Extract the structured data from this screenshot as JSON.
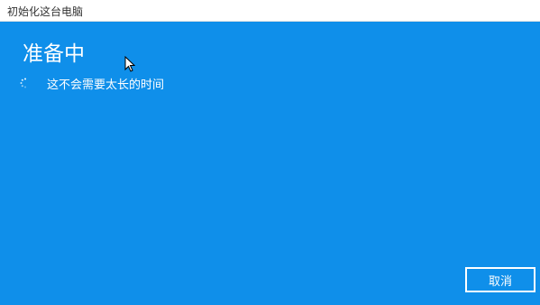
{
  "window": {
    "title": "初始化这台电脑"
  },
  "main": {
    "heading": "准备中",
    "status_text": "这不会需要太长的时间",
    "spinner_icon": "loading-spinner-icon"
  },
  "footer": {
    "cancel_label": "取消"
  },
  "colors": {
    "background": "#0f8fea",
    "text": "#ffffff",
    "titlebar": "#ffffff"
  }
}
